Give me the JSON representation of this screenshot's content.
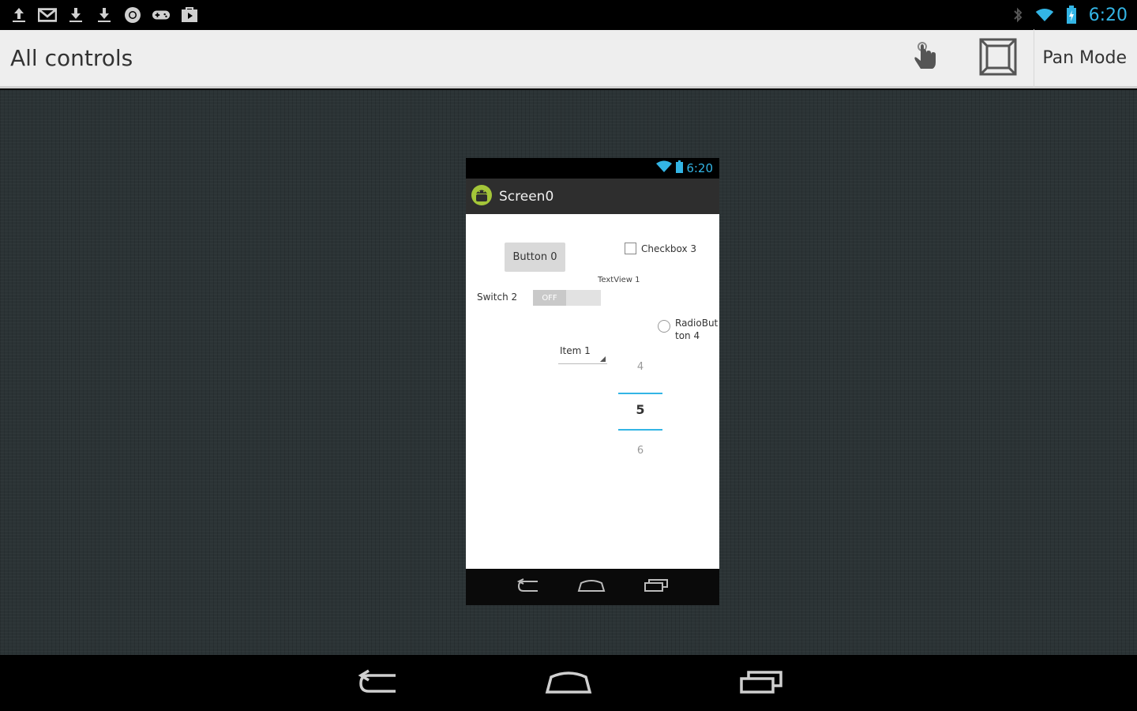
{
  "status_bar": {
    "time": "6:20",
    "left_icons": [
      "upload-icon",
      "gmail-icon",
      "download-icon",
      "download-icon",
      "chrome-icon",
      "gamepad-icon",
      "play-store-icon"
    ],
    "right_icons": [
      "bluetooth-icon",
      "wifi-icon",
      "battery-icon"
    ],
    "accent_color": "#33b5e5"
  },
  "action_bar": {
    "title": "All controls",
    "touch_action_icon": "touch-hand-icon",
    "frame_action_icon": "frame-bounds-icon",
    "pan_mode_label": "Pan Mode"
  },
  "phone_preview": {
    "status_time": "6:20",
    "title": "Screen0",
    "widgets": {
      "button_label": "Button 0",
      "checkbox_label": "Checkbox 3",
      "textview_label": "TextView 1",
      "switch_label": "Switch 2",
      "switch_state": "OFF",
      "radio_label": "RadioButton 4",
      "spinner_value": "Item 1",
      "picker_prev": "4",
      "picker_value": "5",
      "picker_next": "6"
    }
  },
  "system_nav": {
    "back_icon": "back-icon",
    "home_icon": "home-icon",
    "recents_icon": "recents-icon"
  }
}
